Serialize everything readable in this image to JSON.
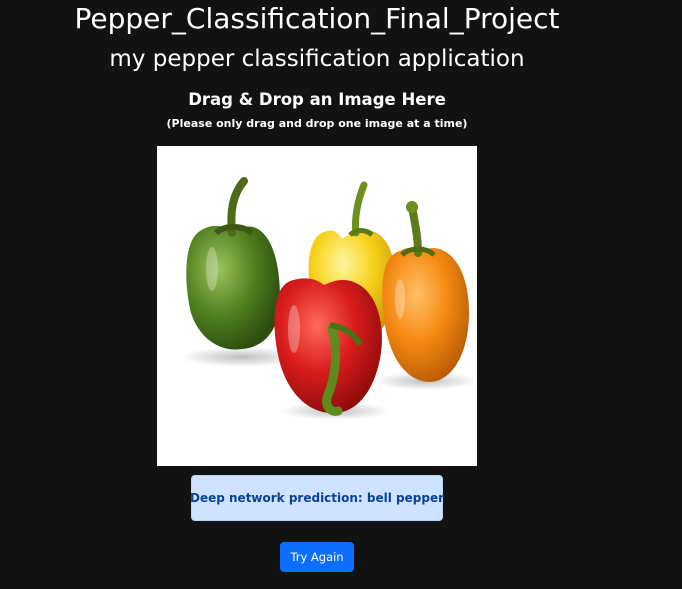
{
  "header": {
    "title": "Pepper_Classification_Final_Project",
    "subtitle": "my pepper classification application"
  },
  "dropzone": {
    "heading": "Drag & Drop an Image Here",
    "note": "(Please only drag and drop one image at a time)",
    "image_subject": "green, red, yellow and orange bell peppers"
  },
  "result": {
    "prediction_text": "Deep network prediction: bell pepper"
  },
  "actions": {
    "try_again_label": "Try Again"
  },
  "colors": {
    "background": "#121212",
    "alert_bg": "#cfe2ff",
    "alert_text": "#084298",
    "primary_button": "#0d6efd"
  }
}
